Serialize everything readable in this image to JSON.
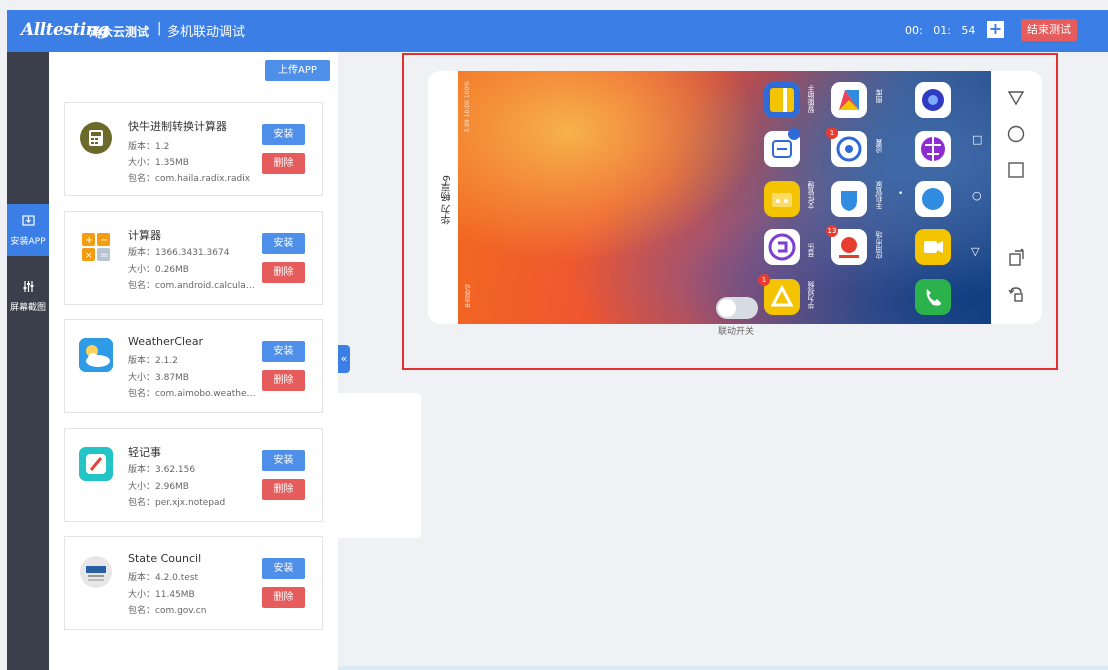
{
  "header": {
    "logo": "Alltesting",
    "logo_cn": "泽众云测试",
    "separator": "|",
    "title": "多机联动调试",
    "timer": {
      "hours": "00:",
      "minutes": "01:",
      "seconds": "54"
    },
    "add_label": "+",
    "end_label": "结束测试"
  },
  "sidebar": {
    "items": [
      {
        "label": "安装APP",
        "icon": "install-icon",
        "active": true
      },
      {
        "label": "屏幕截图",
        "icon": "sliders-icon",
        "active": false
      }
    ]
  },
  "panel": {
    "upload_label": "上传APP",
    "install_label": "安装",
    "delete_label": "删除",
    "apps": [
      {
        "name": "快牛进制转换计算器",
        "version": "版本：1.2",
        "size": "大小：1.35MB",
        "package": "包名：com.haila.radix.radix",
        "icon": "calculator-icon",
        "color": "#6b6a2a"
      },
      {
        "name": "计算器",
        "version": "版本：1366.3431.3674",
        "size": "大小：0.26MB",
        "package": "包名：com.android.calculat...",
        "icon": "calc-orange-icon",
        "color": "#f39c12"
      },
      {
        "name": "WeatherClear",
        "version": "版本：2.1.2",
        "size": "大小：3.87MB",
        "package": "包名：com.aimobo.weather...",
        "icon": "weather-icon",
        "color": "#2e9be6"
      },
      {
        "name": "轻记事",
        "version": "版本：3.62.156",
        "size": "大小：2.96MB",
        "package": "包名：per.xjx.notepad",
        "icon": "notepad-icon",
        "color": "#22c4c6"
      },
      {
        "name": "State Council",
        "version": "版本：4.2.0.test",
        "size": "大小：11.45MB",
        "package": "包名：com.gov.cn",
        "icon": "gov-icon",
        "color": "#e7e7e7"
      }
    ]
  },
  "device": {
    "name": "华为 畅享9",
    "toggle_label": "联动开关",
    "toggle_on": false,
    "apps": [
      {
        "label": "",
        "icon": "notes-yellow-icon",
        "color": "#f5b400"
      },
      {
        "label": "图库",
        "icon": "gallery-icon",
        "color": "#ffffff"
      },
      {
        "label": "",
        "icon": "camera-icon",
        "color": "#ffffff"
      },
      {
        "label": "智能助手",
        "icon": "assistant-icon",
        "color": "#ffffff"
      },
      {
        "label": "设置",
        "icon": "settings-icon",
        "color": "#ffffff"
      },
      {
        "label": "",
        "icon": "browser-icon",
        "color": "#ffffff"
      },
      {
        "label": "文件管理",
        "icon": "files-icon",
        "color": "#f5c400"
      },
      {
        "label": "手机管家",
        "icon": "manager-icon",
        "color": "#ffffff"
      },
      {
        "label": "",
        "icon": "messages-icon",
        "color": "#ffffff"
      },
      {
        "label": "音乐",
        "icon": "music-icon",
        "color": "#ffffff"
      },
      {
        "label": "应用市场",
        "icon": "appstore-icon",
        "color": "#ffffff"
      },
      {
        "label": "",
        "icon": "video-icon",
        "color": "#f5c400"
      },
      {
        "label": "华为视频",
        "icon": "hwvideo-icon",
        "color": "#f5c400"
      },
      {
        "label": "",
        "icon": "phone-icon",
        "color": "#2bb24c"
      }
    ],
    "badges": {
      "assistant": "1",
      "appstore": "13",
      "hwvideo": "1"
    },
    "status_top": "3.99 10:00 100%",
    "status_bottom": "中国移动"
  }
}
